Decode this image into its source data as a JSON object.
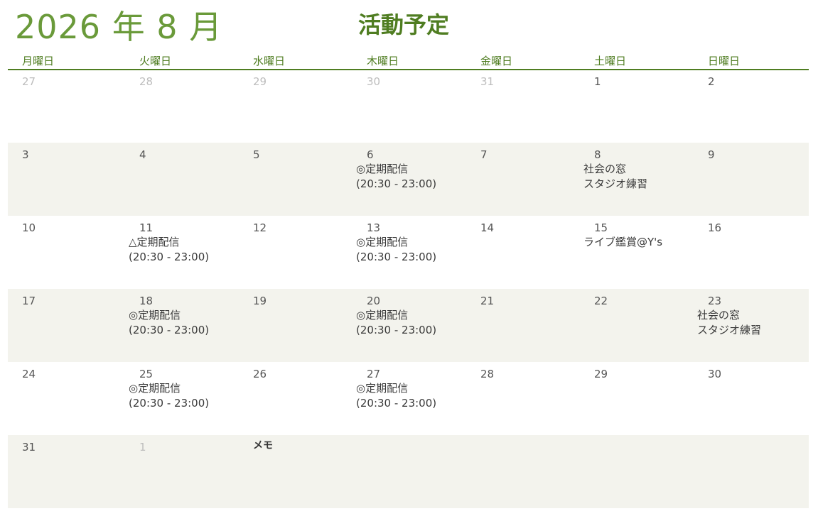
{
  "header": {
    "month_title": "2026 年 8 月",
    "main_title": "活動予定"
  },
  "weekdays": [
    "月曜日",
    "火曜日",
    "水曜日",
    "木曜日",
    "金曜日",
    "土曜日",
    "日曜日"
  ],
  "weeks": [
    {
      "days": [
        "27",
        "28",
        "29",
        "30",
        "31",
        "1",
        "2"
      ]
    },
    {
      "days": [
        "3",
        "4",
        "5",
        "6",
        "7",
        "8",
        "9"
      ]
    },
    {
      "days": [
        "10",
        "11",
        "12",
        "13",
        "14",
        "15",
        "16"
      ]
    },
    {
      "days": [
        "17",
        "18",
        "19",
        "20",
        "21",
        "22",
        "23"
      ]
    },
    {
      "days": [
        "24",
        "25",
        "26",
        "27",
        "28",
        "29",
        "30"
      ]
    },
    {
      "days": [
        "31",
        "1"
      ]
    }
  ],
  "events": {
    "aug06": [
      "◎定期配信",
      "(20:30 - 23:00)"
    ],
    "aug08": [
      "社会の窓",
      "スタジオ練習"
    ],
    "aug11": [
      "△定期配信",
      "(20:30 - 23:00)"
    ],
    "aug13": [
      "◎定期配信",
      "(20:30 - 23:00)"
    ],
    "aug15": [
      "ライブ鑑賞@Y's"
    ],
    "aug18": [
      "◎定期配信",
      "(20:30 - 23:00)"
    ],
    "aug20": [
      "◎定期配信",
      "(20:30 - 23:00)"
    ],
    "aug23": [
      "社会の窓",
      "スタジオ練習"
    ],
    "aug25": [
      "◎定期配信",
      "(20:30 - 23:00)"
    ],
    "aug27": [
      "◎定期配信",
      "(20:30 - 23:00)"
    ]
  },
  "memo": {
    "label": "メモ"
  },
  "colors": {
    "accent": "#4f7d21",
    "title_green": "#6a9a3a",
    "shade": "#f3f3ed",
    "muted_day": "#bdbdbd"
  }
}
